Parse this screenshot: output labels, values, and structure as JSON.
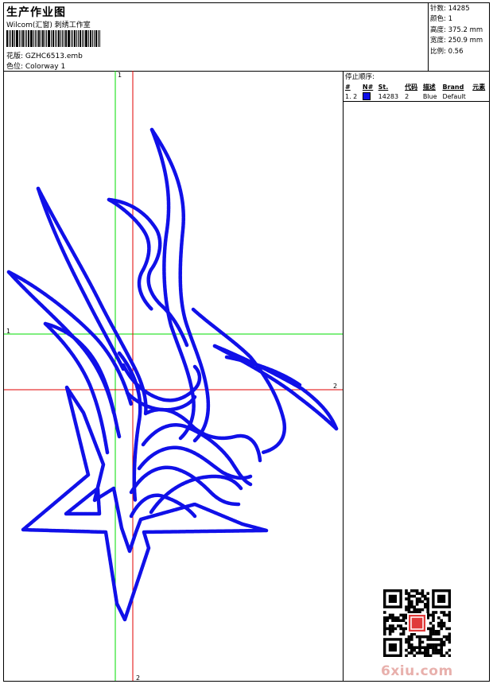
{
  "header": {
    "title": "生产作业图",
    "studio": "Wilcom(汇窗) 刺绣工作室",
    "design": "花版:  GZHC6513.emb",
    "colorway": "色位:  Colorway 1"
  },
  "stats": {
    "stitches": "针数:  14285",
    "colors": "颜色:  1",
    "height": "高度:  375.2 mm",
    "width": "宽度:  250.9 mm",
    "scale": "比例:  0.56"
  },
  "stop_sequence": {
    "title": "停止顺序:",
    "headers": [
      "#",
      "N#",
      "St.",
      "代码",
      "描述",
      "Brand",
      "元素"
    ],
    "rows": [
      {
        "idx": "1. 2",
        "stitches": "14283",
        "code": "2",
        "desc": "Blue",
        "brand": "Default"
      }
    ]
  },
  "guides": {
    "green_top": "1",
    "green_left": "1",
    "red_right": "2",
    "red_bottom": "2"
  },
  "colors": {
    "thread": "#1010e8",
    "guide_green": "#00dd00",
    "guide_red": "#e00000"
  },
  "watermark": "6xiu.com"
}
